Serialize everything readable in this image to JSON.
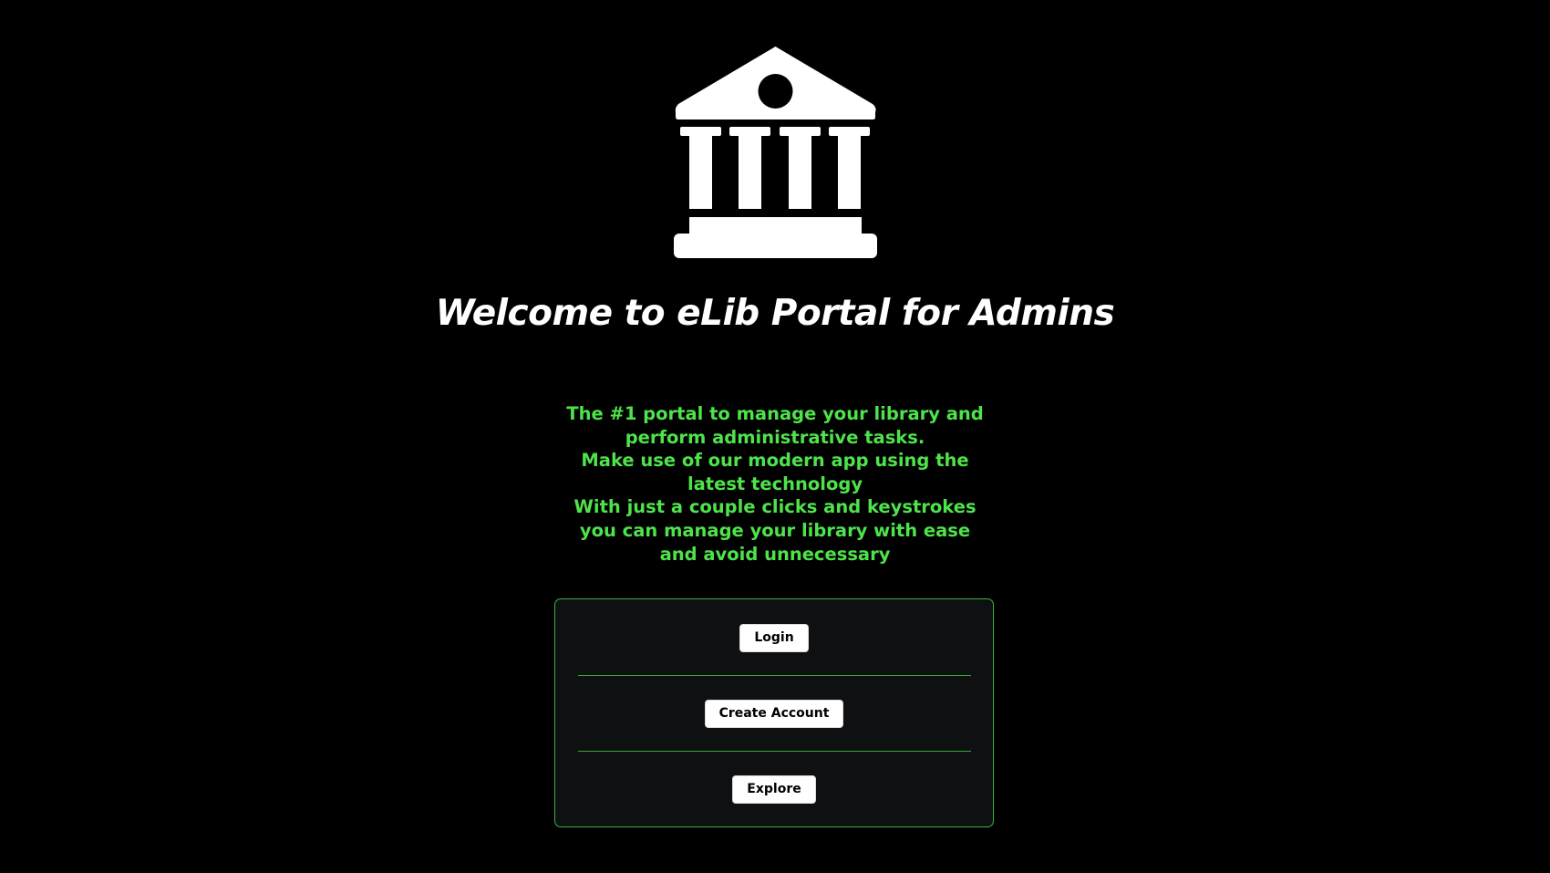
{
  "logo": {
    "icon": "landmark-icon",
    "color": "#ffffff"
  },
  "title": "Welcome to eLib Portal for Admins",
  "tagline": [
    "The #1 portal to manage your library and",
    "perform administrative tasks.",
    "Make use of our modern app using the",
    "latest technology",
    "With just a couple clicks and keystrokes",
    "you can manage your library with ease",
    "and avoid unnecessary"
  ],
  "actions": {
    "login_label": "Login",
    "create_account_label": "Create Account",
    "explore_label": "Explore"
  },
  "colors": {
    "background": "#000000",
    "accent_text": "#4ee34a",
    "card_border": "#3bb33a",
    "card_background": "#0e1012",
    "button_background": "#ffffff"
  }
}
